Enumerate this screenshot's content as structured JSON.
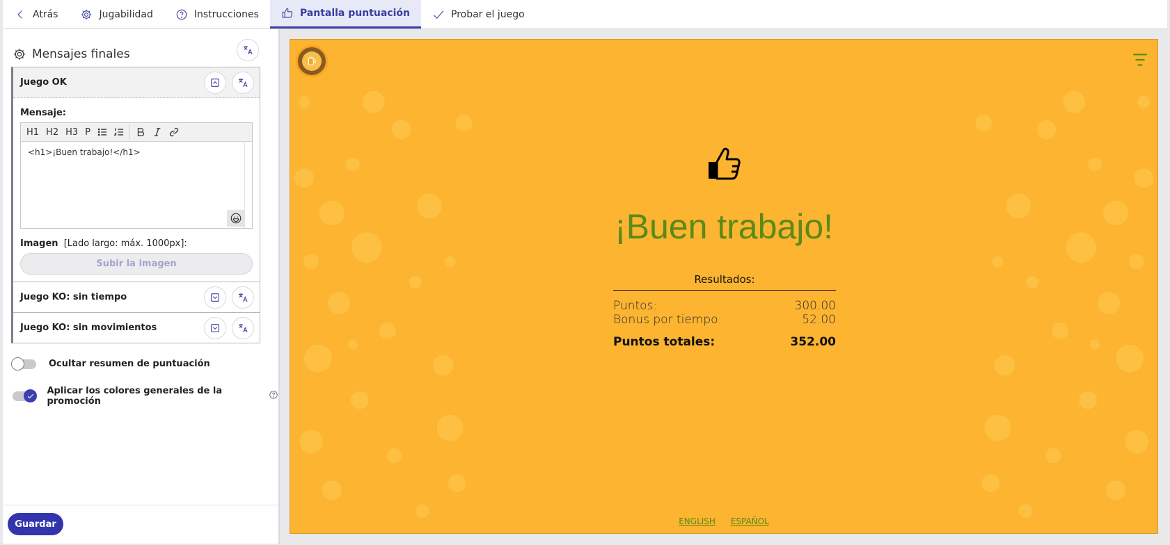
{
  "tabs": [
    {
      "label": "Atrás",
      "icon": "chevron-left-icon"
    },
    {
      "label": "Jugabilidad",
      "icon": "gear-icon"
    },
    {
      "label": "Instrucciones",
      "icon": "help-circle-icon"
    },
    {
      "label": "Pantalla puntuación",
      "icon": "thumb-up-icon",
      "active": true
    },
    {
      "label": "Probar el juego",
      "icon": "check-icon"
    }
  ],
  "panel": {
    "title": "Mensajes finales",
    "sections": {
      "ok": {
        "label": "Juego OK",
        "message_label": "Mensaje:",
        "toolbar": [
          "H1",
          "H2",
          "H3",
          "P"
        ],
        "message_value": "<h1>¡Buen trabajo!</h1>",
        "image_label": "Imagen",
        "image_hint": "[Lado largo: máx. 1000px]:",
        "upload_label": "Subir la imagen"
      },
      "ko_time": {
        "label": "Juego KO: sin tiempo"
      },
      "ko_moves": {
        "label": "Juego KO: sin movimientos"
      }
    },
    "toggles": {
      "hide_summary": {
        "label": "Ocultar resumen de puntuación",
        "on": false
      },
      "apply_colors": {
        "label": "Aplicar los colores generales de la promoción",
        "on": true
      }
    },
    "save_label": "Guardar"
  },
  "preview": {
    "title": "¡Buen trabajo!",
    "results_label": "Resultados:",
    "rows": [
      {
        "label": "Puntos:",
        "value": "300.00"
      },
      {
        "label": "Bonus por tiempo:",
        "value": "52.00"
      }
    ],
    "total": {
      "label": "Puntos totales:",
      "value": "352.00"
    },
    "languages": [
      "ENGLISH",
      "ESPAÑOL"
    ],
    "colors": {
      "background": "#fcb431",
      "title": "#5a8a18",
      "accent": "#3235ad"
    }
  }
}
